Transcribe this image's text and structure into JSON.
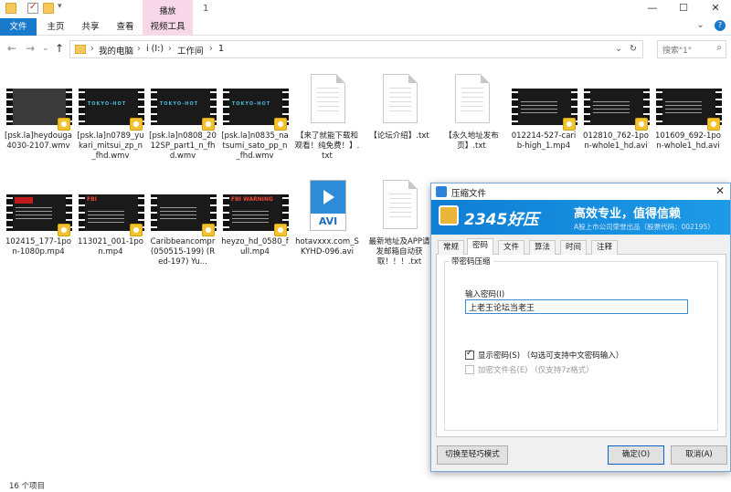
{
  "window": {
    "title": "1",
    "context_tab": "播放",
    "controls": {
      "minimize": "—",
      "maximize": "☐",
      "close": "✕"
    }
  },
  "ribbon": {
    "tabs": [
      "文件",
      "主页",
      "共享",
      "查看",
      "视频工具"
    ],
    "expand": "⌄",
    "help": "?"
  },
  "address": {
    "crumbs": [
      "我的电脑",
      "i (I:)",
      "工作间",
      "1"
    ],
    "separators": [
      "›",
      "›",
      "›",
      "›"
    ],
    "dropdown": "⌄",
    "refresh": "↻",
    "search_placeholder": "搜索\"1\"",
    "nav": {
      "back": "←",
      "forward": "→",
      "recent": "⌄",
      "up": "↑"
    }
  },
  "files": [
    {
      "name": "[psk.la]heydouga4030-2107.wmv",
      "kind": "video",
      "style": "gray"
    },
    {
      "name": "[psk.la]n0789_yukari_mitsui_zp_n_fhd.wmv",
      "kind": "video",
      "style": "tokyo",
      "thumb_text": "TOKYO-HOT"
    },
    {
      "name": "[psk.la]n0808_2012SP_part1_n_fhd.wmv",
      "kind": "video",
      "style": "tokyo",
      "thumb_text": "TOKYO-HOT"
    },
    {
      "name": "[psk.la]n0835_natsumi_sato_pp_n_fhd.wmv",
      "kind": "video",
      "style": "tokyo",
      "thumb_text": "TOKYO-HOT"
    },
    {
      "name": "【来了就能下载和观看！纯免费！】.txt",
      "kind": "txt"
    },
    {
      "name": "【论坛介绍】.txt",
      "kind": "txt"
    },
    {
      "name": "【永久地址发布页】.txt",
      "kind": "txt"
    },
    {
      "name": "012214-527-carib-high_1.mp4",
      "kind": "video",
      "style": "lines"
    },
    {
      "name": "012810_762-1pon-whole1_hd.avi",
      "kind": "video",
      "style": "lines"
    },
    {
      "name": "101609_692-1pon-whole1_hd.avi",
      "kind": "video",
      "style": "lines"
    },
    {
      "name": "102415_177-1pon-1080p.mp4",
      "kind": "video",
      "style": "redlines"
    },
    {
      "name": "113021_001-1pon.mp4",
      "kind": "video",
      "style": "fbi",
      "thumb_text": "FBI"
    },
    {
      "name": "Caribbeancompr (050515-199) (Red-197) Yu...",
      "kind": "video",
      "style": "lines"
    },
    {
      "name": "heyzo_hd_0580_full.mp4",
      "kind": "video",
      "style": "fbi",
      "thumb_text": "FBI WARNING"
    },
    {
      "name": "hotavxxx.com_SKYHD-096.avi",
      "kind": "avi",
      "badge": "AVI"
    },
    {
      "name": "最新地址及APP请发邮箱自动获取！！！.txt",
      "kind": "txt"
    }
  ],
  "status": {
    "count": "16 个项目"
  },
  "dialog": {
    "title": "压缩文件",
    "close": "✕",
    "brand": "2345好压",
    "slogan": "高效专业，值得信赖",
    "sub": "A股上市公司荣誉出品（股票代码：002195）",
    "tabs": [
      "常规",
      "密码",
      "文件",
      "算法",
      "时间",
      "注释"
    ],
    "active_tab": 1,
    "group_title": "带密码压缩",
    "password_label": "输入密码(I)",
    "password_value": "上老王论坛当老王",
    "show_password": "显示密码(S) （勾选可支持中文密码输入）",
    "encrypt_names": "加密文件名(E) （仅支持7z格式）",
    "show_password_checked": true,
    "encrypt_names_checked": false,
    "buttons": {
      "simple": "切换至轻巧模式",
      "ok": "确定(O)",
      "cancel": "取消(A)"
    }
  }
}
